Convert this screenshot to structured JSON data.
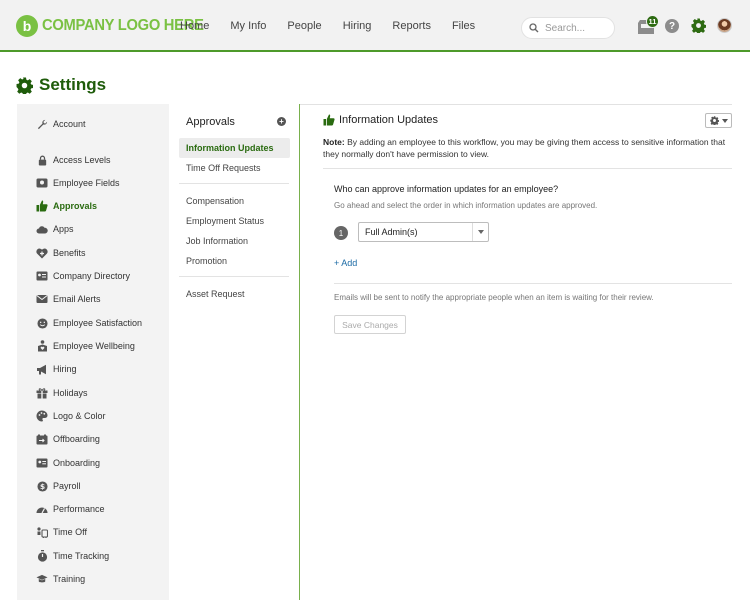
{
  "header": {
    "logo_text": "COMPANY LOGO HERE",
    "logo_mark": "b",
    "nav": [
      "Home",
      "My Info",
      "People",
      "Hiring",
      "Reports",
      "Files"
    ],
    "search_placeholder": "Search...",
    "inbox_count": "11",
    "help_glyph": "?"
  },
  "page": {
    "title": "Settings"
  },
  "sidebar": {
    "items": [
      {
        "label": "Account",
        "icon": "wrench-icon"
      },
      {
        "label": "Access Levels",
        "icon": "lock-icon"
      },
      {
        "label": "Employee Fields",
        "icon": "id-card-icon"
      },
      {
        "label": "Approvals",
        "icon": "thumbs-up-icon",
        "active": true
      },
      {
        "label": "Apps",
        "icon": "cloud-icon"
      },
      {
        "label": "Benefits",
        "icon": "heart-plus-icon"
      },
      {
        "label": "Company Directory",
        "icon": "directory-icon"
      },
      {
        "label": "Email Alerts",
        "icon": "envelope-icon"
      },
      {
        "label": "Employee Satisfaction",
        "icon": "smiley-icon"
      },
      {
        "label": "Employee Wellbeing",
        "icon": "wellbeing-icon"
      },
      {
        "label": "Hiring",
        "icon": "megaphone-icon"
      },
      {
        "label": "Holidays",
        "icon": "gift-icon"
      },
      {
        "label": "Logo & Color",
        "icon": "palette-icon"
      },
      {
        "label": "Offboarding",
        "icon": "exit-icon"
      },
      {
        "label": "Onboarding",
        "icon": "badge-icon"
      },
      {
        "label": "Payroll",
        "icon": "dollar-icon"
      },
      {
        "label": "Performance",
        "icon": "gauge-icon"
      },
      {
        "label": "Time Off",
        "icon": "plane-icon"
      },
      {
        "label": "Time Tracking",
        "icon": "stopwatch-icon"
      },
      {
        "label": "Training",
        "icon": "graduation-cap-icon"
      }
    ]
  },
  "approvals": {
    "title": "Approvals",
    "items": [
      {
        "label": "Information Updates",
        "active": true
      },
      {
        "label": "Time Off Requests"
      },
      {
        "label": "Compensation"
      },
      {
        "label": "Employment Status"
      },
      {
        "label": "Job Information"
      },
      {
        "label": "Promotion"
      },
      {
        "label": "Asset Request"
      }
    ]
  },
  "main": {
    "title": "Information Updates",
    "note_label": "Note:",
    "note_text": "By adding an employee to this workflow, you may be giving them access to sensitive information that they normally don't have permission to view.",
    "question": "Who can approve information updates for an employee?",
    "subtext": "Go ahead and select the order in which information updates are approved.",
    "approver_step": "1",
    "approver_value": "Full Admin(s)",
    "add_label": "+ Add",
    "email_note": "Emails will be sent to notify the appropriate people when an item is waiting for their review.",
    "save_label": "Save Changes"
  },
  "colors": {
    "brand_green": "#7ac143",
    "dark_green": "#1f5c0b",
    "link_blue": "#1b6aa5"
  }
}
